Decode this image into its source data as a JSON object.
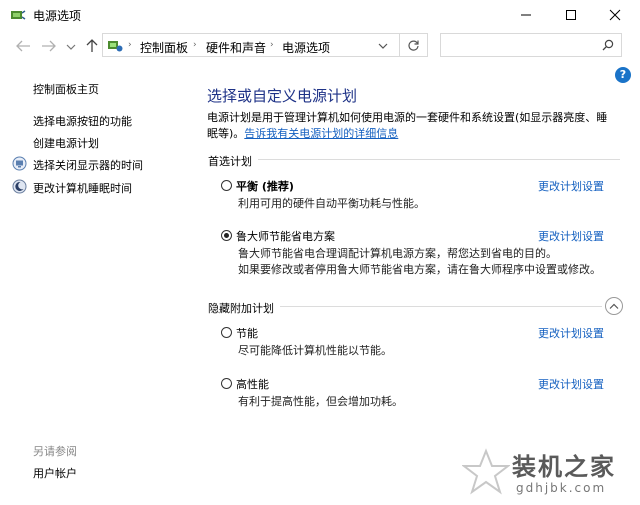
{
  "window": {
    "title": "电源选项",
    "controls": {
      "minimize": "minimize-icon",
      "maximize": "maximize-icon",
      "close": "close-icon"
    }
  },
  "address": {
    "breadcrumbs": [
      "控制面板",
      "硬件和声音",
      "电源选项"
    ],
    "search_placeholder": ""
  },
  "sidebar": {
    "home": "控制面板主页",
    "items": [
      {
        "label": "选择电源按钮的功能",
        "icon": ""
      },
      {
        "label": "创建电源计划",
        "icon": ""
      },
      {
        "label": "选择关闭显示器的时间",
        "icon": "monitor-icon"
      },
      {
        "label": "更改计算机睡眠时间",
        "icon": "moon-icon"
      }
    ],
    "see_also_title": "另请参阅",
    "see_also": [
      "用户帐户"
    ]
  },
  "main": {
    "heading": "选择或自定义电源计划",
    "intro_text": "电源计划是用于管理计算机如何使用电源的一套硬件和系统设置(如显示器亮度、睡眠等)。",
    "intro_link": "告诉我有关电源计划的详细信息",
    "preferred_title": "首选计划",
    "preferred_plans": [
      {
        "name": "平衡 (推荐)",
        "desc": [
          "利用可用的硬件自动平衡功耗与性能。"
        ],
        "link": "更改计划设置",
        "selected": false
      },
      {
        "name": "鲁大师节能省电方案",
        "desc": [
          "鲁大师节能省电合理调配计算机电源方案，帮您达到省电的目的。",
          "如果要修改或者停用鲁大师节能省电方案，请在鲁大师程序中设置或修改。"
        ],
        "link": "更改计划设置",
        "selected": true
      }
    ],
    "hidden_title": "隐藏附加计划",
    "hidden_plans": [
      {
        "name": "节能",
        "desc": [
          "尽可能降低计算机性能以节能。"
        ],
        "link": "更改计划设置",
        "selected": false
      },
      {
        "name": "高性能",
        "desc": [
          "有利于提高性能，但会增加功耗。"
        ],
        "link": "更改计划设置",
        "selected": false
      }
    ]
  },
  "watermark": {
    "main": "装机之家",
    "sub": "gdhjbk.com"
  },
  "colors": {
    "heading": "#1e3287",
    "link": "#1460c0",
    "help": "#1a73c8"
  }
}
